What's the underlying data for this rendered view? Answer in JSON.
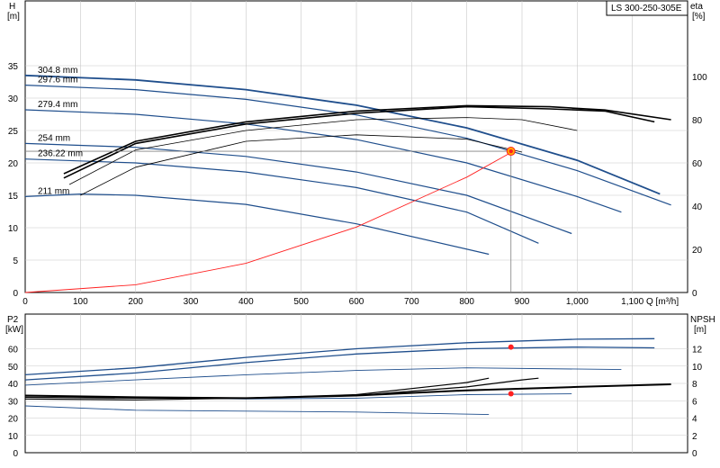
{
  "pump_model": "LS 300-250-305E",
  "chart_data": [
    {
      "type": "line",
      "title": "",
      "y_left_label": "H",
      "y_left_unit": "[m]",
      "y_right_label": "eta",
      "y_right_unit": "[%]",
      "x_label": "Q [m³/h]",
      "xlim": [
        0,
        1200
      ],
      "ylim_left": [
        0,
        40
      ],
      "ylim_right": [
        0,
        120
      ],
      "x_ticks": [
        "0",
        "100",
        "200",
        "300",
        "400",
        "500",
        "600",
        "700",
        "800",
        "900",
        "1,000",
        "1,100"
      ],
      "y_left_ticks": [
        "0",
        "5",
        "10",
        "15",
        "20",
        "25",
        "30",
        "35"
      ],
      "y_right_ticks": [
        "0",
        "20",
        "40",
        "60",
        "80",
        "100"
      ],
      "grid": true,
      "head_curves": [
        {
          "name": "304.8 mm",
          "x": [
            0,
            200,
            400,
            600,
            800,
            1000,
            1150
          ],
          "y": [
            33.5,
            32.8,
            31.3,
            28.9,
            25.4,
            20.4,
            15.2
          ]
        },
        {
          "name": "297.6 mm",
          "x": [
            0,
            200,
            400,
            600,
            800,
            1000,
            1170
          ],
          "y": [
            32.0,
            31.3,
            29.8,
            27.4,
            23.8,
            18.8,
            13.5
          ]
        },
        {
          "name": "279.4 mm",
          "x": [
            0,
            200,
            400,
            600,
            800,
            1000,
            1080
          ],
          "y": [
            28.2,
            27.5,
            26.0,
            23.6,
            20.0,
            14.8,
            12.4
          ]
        },
        {
          "name": "254 mm",
          "x": [
            0,
            200,
            400,
            600,
            800,
            990
          ],
          "y": [
            23.0,
            22.4,
            21.0,
            18.6,
            15.0,
            9.1
          ]
        },
        {
          "name": "236.22 mm",
          "x": [
            0,
            200,
            400,
            600,
            800,
            930
          ],
          "y": [
            20.6,
            20.0,
            18.6,
            16.2,
            12.4,
            7.6
          ]
        },
        {
          "name": "211 mm",
          "x": [
            0,
            100,
            200,
            400,
            600,
            840
          ],
          "y": [
            14.8,
            15.2,
            15.0,
            13.6,
            10.6,
            5.9
          ]
        }
      ],
      "efficiency_curves": [
        {
          "x": [
            70,
            200,
            400,
            600,
            800,
            950,
            1050,
            1170
          ],
          "y": [
            55,
            70,
            79,
            84,
            86.5,
            86,
            84.5,
            80
          ]
        },
        {
          "x": [
            70,
            200,
            400,
            600,
            800,
            950,
            1050,
            1140
          ],
          "y": [
            53,
            69,
            78,
            83,
            86,
            85,
            84,
            79
          ]
        },
        {
          "x": [
            80,
            200,
            400,
            600,
            800,
            900,
            1000
          ],
          "y": [
            50,
            66,
            75,
            80,
            81,
            80,
            75
          ]
        },
        {
          "x": [
            100,
            200,
            400,
            600,
            800,
            900
          ],
          "y": [
            45,
            58,
            70,
            73,
            71,
            65
          ]
        }
      ],
      "system_curve": {
        "x": [
          0,
          200,
          400,
          600,
          800,
          880
        ],
        "y": [
          0,
          1.2,
          4.5,
          10.1,
          17.8,
          21.6
        ]
      },
      "operating_point": {
        "q": 880,
        "h": 21.8,
        "eta": 84
      }
    },
    {
      "type": "line",
      "y_left_label": "P2",
      "y_left_unit": "[kW]",
      "y_right_label": "NPSH",
      "y_right_unit": "[m]",
      "xlim": [
        0,
        1200
      ],
      "ylim_left": [
        0,
        70
      ],
      "ylim_right": [
        0,
        14
      ],
      "y_left_ticks": [
        "0",
        "10",
        "20",
        "30",
        "40",
        "50",
        "60"
      ],
      "y_right_ticks": [
        "0",
        "2",
        "4",
        "6",
        "8",
        "10",
        "12"
      ],
      "power_curves": [
        {
          "x": [
            0,
            200,
            400,
            600,
            800,
            1000,
            1140
          ],
          "y": [
            45,
            49,
            55,
            60,
            63.5,
            65.5,
            65.8
          ]
        },
        {
          "x": [
            0,
            200,
            400,
            600,
            800,
            1000,
            1140
          ],
          "y": [
            42,
            46,
            52,
            57,
            60,
            61,
            60.5
          ]
        },
        {
          "x": [
            0,
            200,
            400,
            600,
            800,
            1080
          ],
          "y": [
            39,
            42,
            45,
            47.5,
            49,
            48
          ]
        },
        {
          "x": [
            0,
            200,
            400,
            600,
            800,
            990
          ],
          "y": [
            33,
            32,
            31,
            31.5,
            33.5,
            34
          ]
        },
        {
          "x": [
            0,
            200,
            400,
            600,
            840
          ],
          "y": [
            27,
            24.5,
            24,
            23.5,
            22
          ]
        }
      ],
      "npsh_curves": [
        {
          "x": [
            0,
            200,
            400,
            600,
            800,
            1000,
            1170
          ],
          "y": [
            6.6,
            6.4,
            6.3,
            6.6,
            7.2,
            7.6,
            7.9
          ]
        },
        {
          "x": [
            0,
            200,
            400,
            600,
            800,
            900,
            930
          ],
          "y": [
            6.4,
            6.3,
            6.3,
            6.6,
            7.6,
            8.4,
            8.6
          ]
        },
        {
          "x": [
            0,
            200,
            400,
            600,
            800,
            840
          ],
          "y": [
            6.2,
            6.1,
            6.3,
            6.7,
            8.1,
            8.6
          ]
        }
      ],
      "operating_points": [
        {
          "q": 880,
          "p2": 61
        },
        {
          "q": 880,
          "npsh": 6.8
        }
      ]
    }
  ],
  "colors": {
    "head": "#1f4e8c",
    "efficiency": "#000000",
    "system": "#ff2020",
    "point": "#ff2020",
    "point_fill": "#ffb000",
    "grid": "#c8c8c8"
  }
}
